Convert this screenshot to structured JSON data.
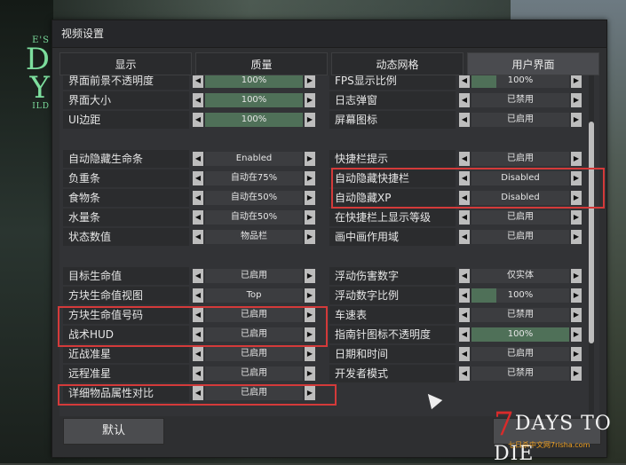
{
  "window": {
    "title": "视频设置"
  },
  "logo": {
    "line1": "E'S",
    "line2": "D\nY",
    "line3": "ILD"
  },
  "tabs": [
    {
      "label": "显示"
    },
    {
      "label": "质量"
    },
    {
      "label": "动态网格"
    },
    {
      "label": "用户界面"
    }
  ],
  "left_rows": [
    {
      "label": "界面前景不透明度",
      "value": "100%",
      "fill": 1.0
    },
    {
      "label": "界面大小",
      "value": "100%",
      "fill": 1.0
    },
    {
      "label": "UI边距",
      "value": "100%",
      "fill": 1.0
    },
    {
      "label": "自动隐藏生命条",
      "value": "Enabled"
    },
    {
      "label": "负重条",
      "value": "自动在75%"
    },
    {
      "label": "食物条",
      "value": "自动在50%"
    },
    {
      "label": "水量条",
      "value": "自动在50%"
    },
    {
      "label": "状态数值",
      "value": "物品栏"
    },
    {
      "label": "目标生命值",
      "value": "已启用"
    },
    {
      "label": "方块生命值视图",
      "value": "Top"
    },
    {
      "label": "方块生命值号码",
      "value": "已启用"
    },
    {
      "label": "战术HUD",
      "value": "已启用"
    },
    {
      "label": "近战准星",
      "value": "已启用"
    },
    {
      "label": "远程准星",
      "value": "已启用"
    },
    {
      "label": "详细物品属性对比",
      "value": "已启用"
    }
  ],
  "right_rows": [
    {
      "label": "FPS显示比例",
      "value": "100%",
      "fill": 0.25
    },
    {
      "label": "日志弹窗",
      "value": "已禁用"
    },
    {
      "label": "屏幕图标",
      "value": "已启用"
    },
    {
      "label": "快捷栏提示",
      "value": "已启用"
    },
    {
      "label": "自动隐藏快捷栏",
      "value": "Disabled"
    },
    {
      "label": "自动隐藏XP",
      "value": "Disabled"
    },
    {
      "label": "在快捷栏上显示等级",
      "value": "已启用"
    },
    {
      "label": "画中画作用域",
      "value": "已启用"
    },
    {
      "label": "浮动伤害数字",
      "value": "仅实体"
    },
    {
      "label": "浮动数字比例",
      "value": "100%",
      "fill": 0.25
    },
    {
      "label": "车速表",
      "value": "已禁用"
    },
    {
      "label": "指南针图标不透明度",
      "value": "100%",
      "fill": 1.0
    },
    {
      "label": "日期和时间",
      "value": "已启用"
    },
    {
      "label": "开发者模式",
      "value": "已禁用"
    }
  ],
  "buttons": {
    "default_label": "默认"
  },
  "watermark": {
    "seven": "7",
    "title": "DAYS TO DIE",
    "subtitle": "七日杀中文网7risha.com"
  },
  "colors": {
    "highlight": "#d43a3a",
    "slider_fill": "#4f7058"
  }
}
